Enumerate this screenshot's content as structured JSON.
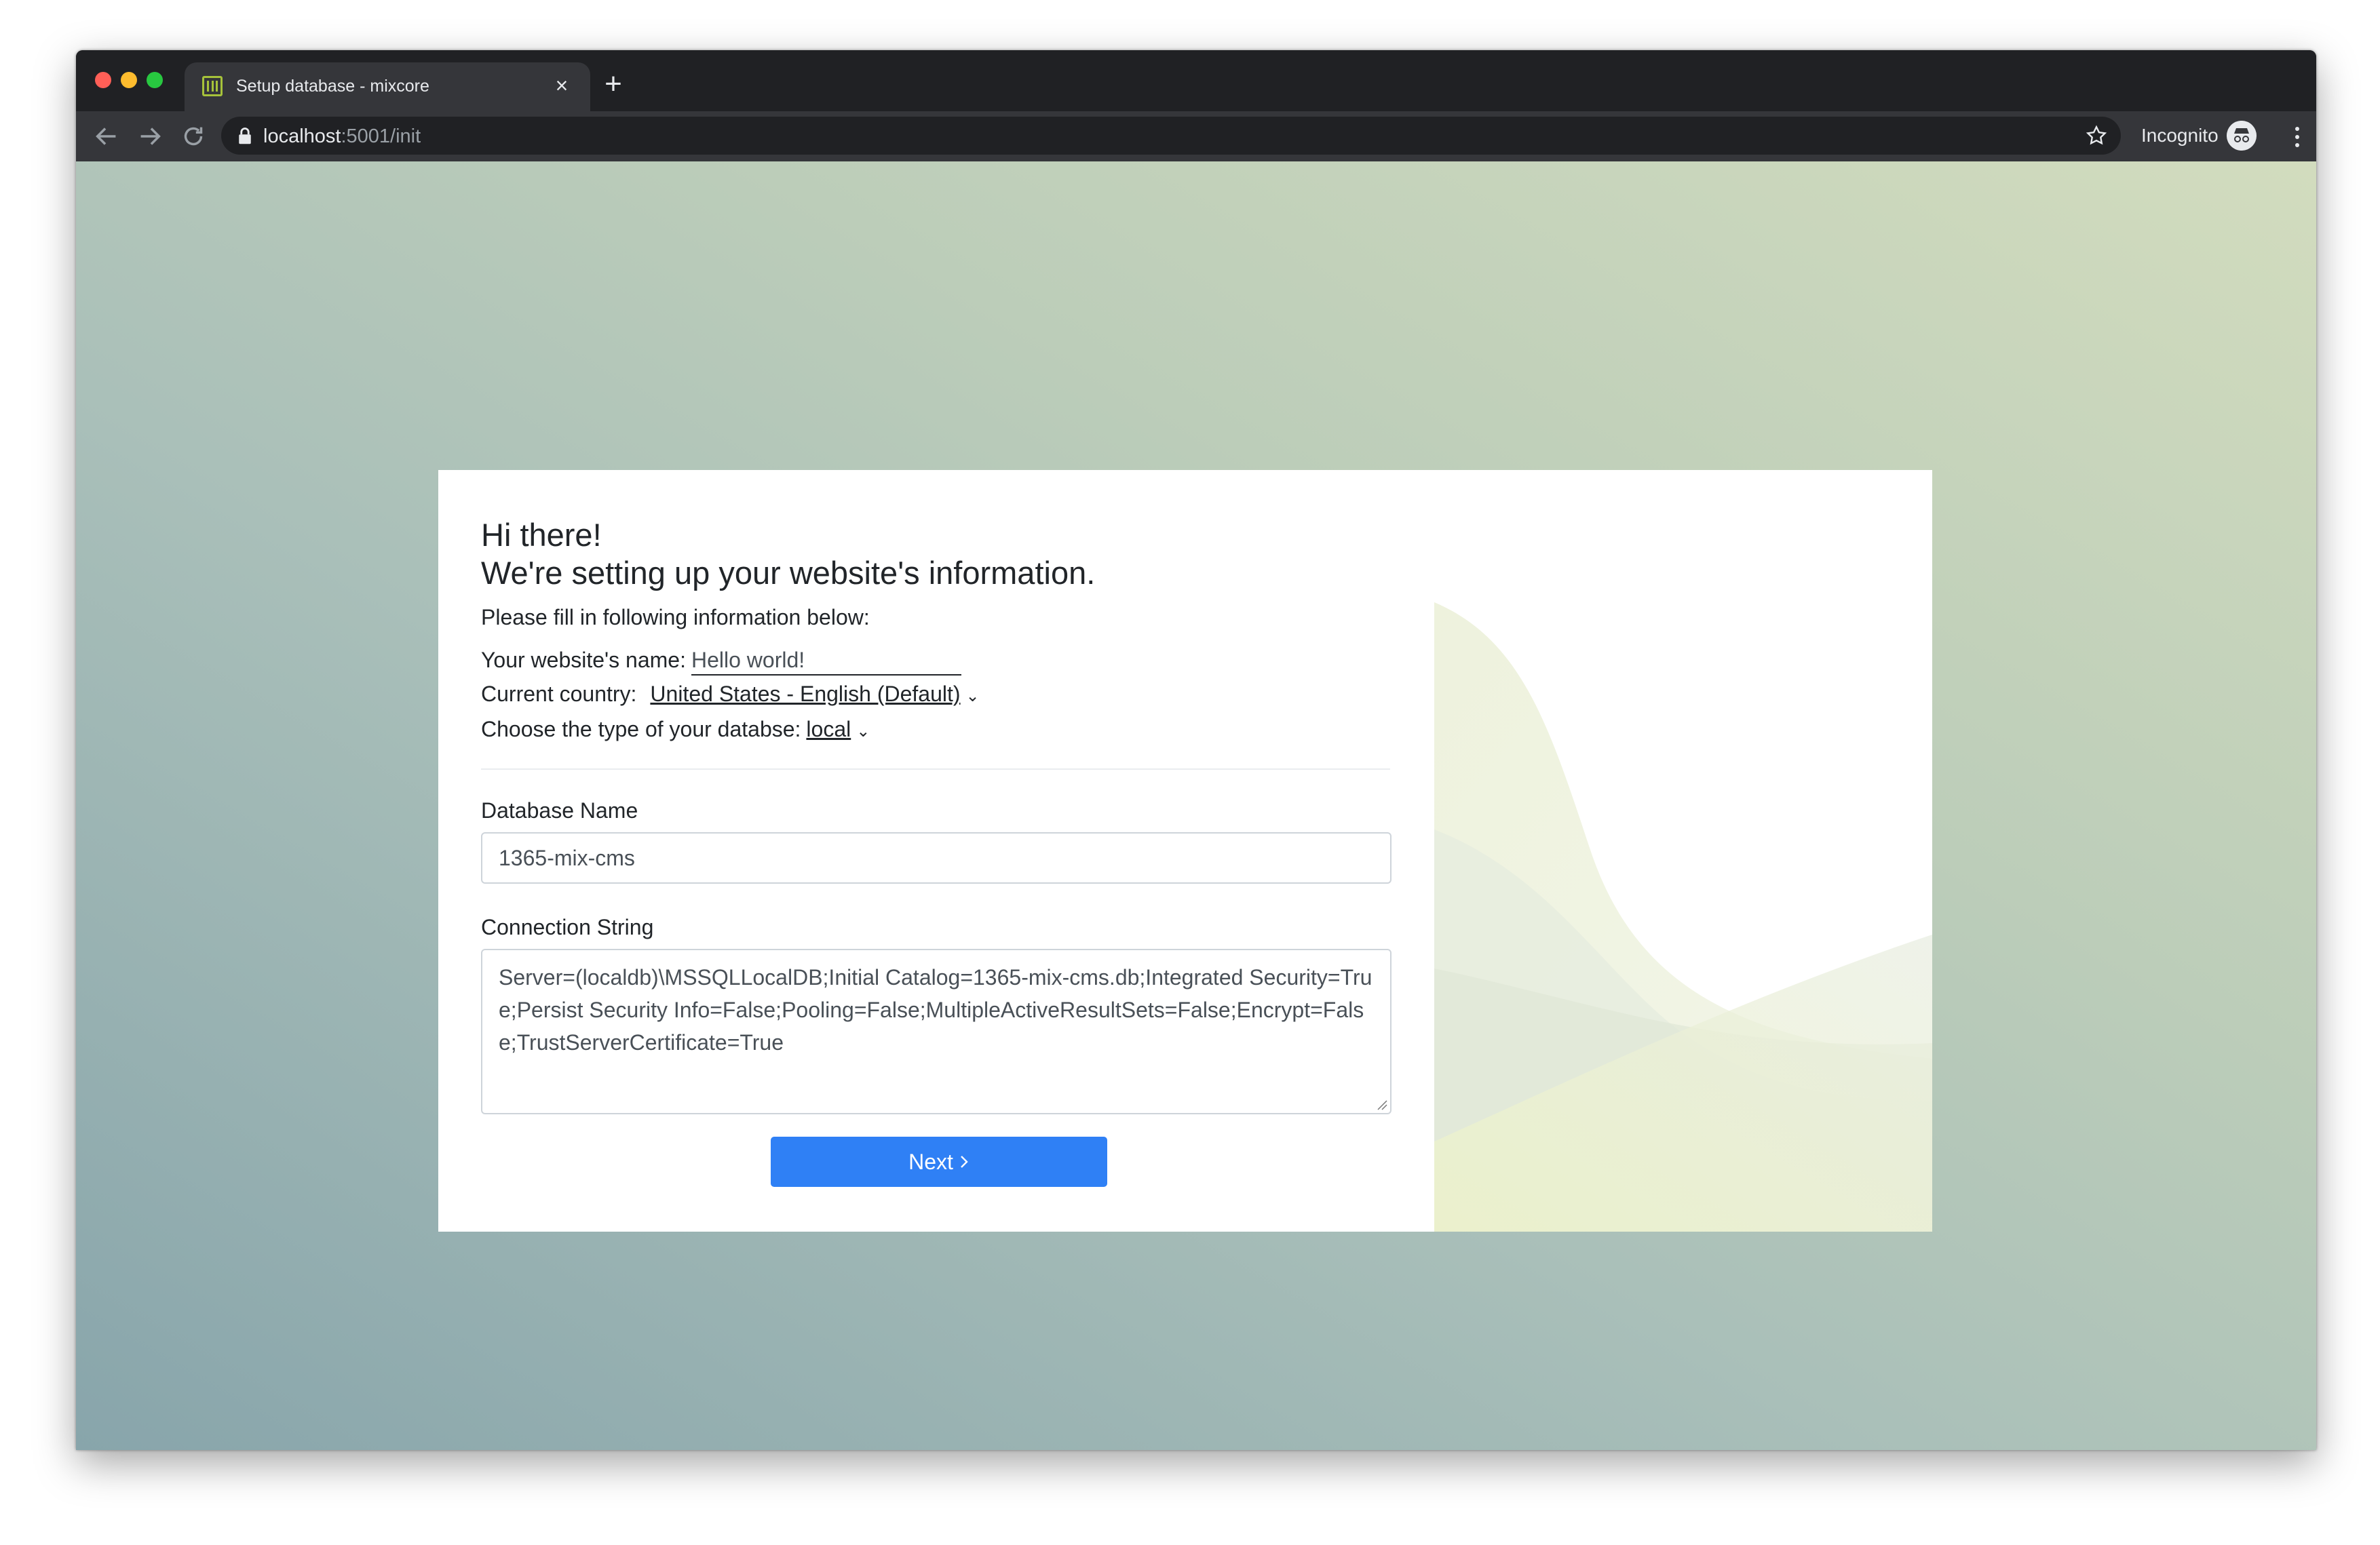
{
  "browser": {
    "tab": {
      "title": "Setup database - mixcore",
      "close": "×"
    },
    "new_tab": "+",
    "url": {
      "host": "localhost",
      "path": ":5001/init"
    },
    "incognito_label": "Incognito"
  },
  "form": {
    "greeting": "Hi there!",
    "heading": "We're setting up your website's information.",
    "intro": "Please fill in following information below:",
    "site_name": {
      "label": "Your website's name:",
      "value": "Hello world!"
    },
    "country": {
      "label": "Current country:",
      "value": "United States - English (Default)"
    },
    "db_type": {
      "label": "Choose the type of your databse:",
      "value": "local"
    },
    "database_name": {
      "label": "Database Name",
      "value": "1365-mix-cms"
    },
    "connection_string": {
      "label": "Connection String",
      "value": "Server=(localdb)\\MSSQLLocalDB;Initial Catalog=1365-mix-cms.db;Integrated Security=True;Persist Security Info=False;Pooling=False;MultipleActiveResultSets=False;Encrypt=False;TrustServerCertificate=True"
    },
    "next_button": "Next"
  },
  "colors": {
    "primary": "#2f80f5",
    "accent_green": "#a6c23a"
  },
  "icons": [
    "back-arrow-icon",
    "forward-arrow-icon",
    "reload-icon",
    "lock-icon",
    "star-icon",
    "incognito-icon",
    "more-menu-icon",
    "chevron-down-icon",
    "chevron-right-icon"
  ]
}
